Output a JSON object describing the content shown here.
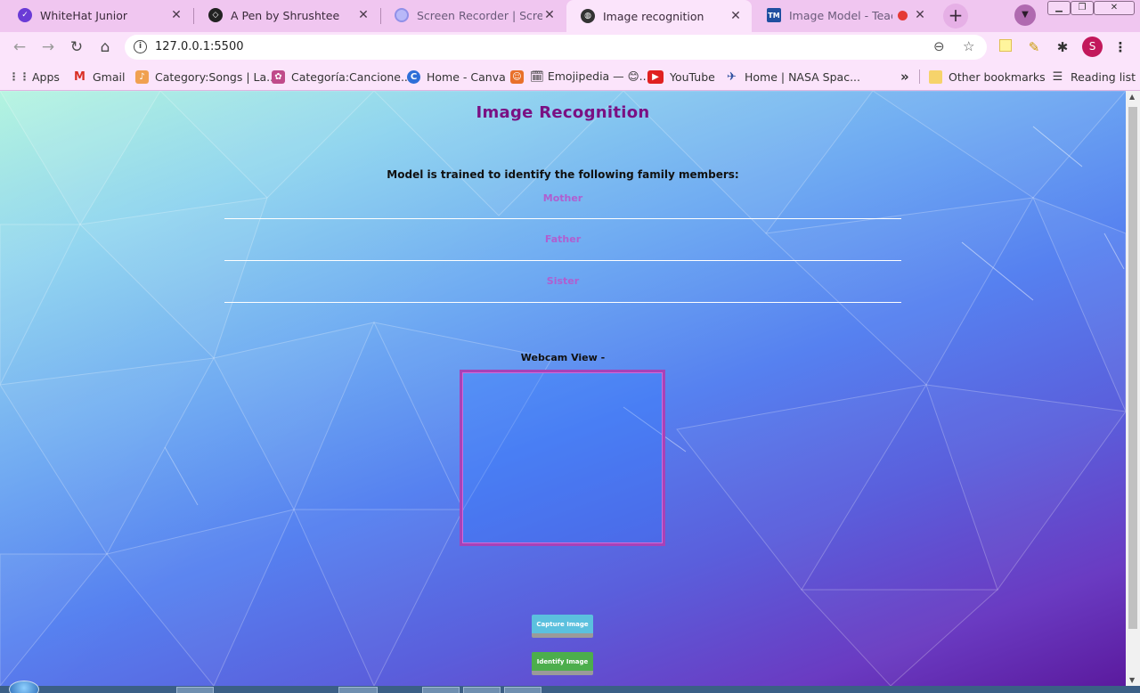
{
  "browser": {
    "tabs": [
      {
        "title": "WhiteHat Junior",
        "icon": "whitehat-icon"
      },
      {
        "title": "A Pen by Shrushtee",
        "icon": "codepen-icon"
      },
      {
        "title": "Screen Recorder | Screencast",
        "icon": "screencast-icon"
      },
      {
        "title": "Image recognition",
        "icon": "globe-icon",
        "active": true
      },
      {
        "title": "Image Model - Teachable Machine",
        "icon": "tm-icon"
      }
    ],
    "tab_close": "✕",
    "new_tab": "+",
    "url": "127.0.0.1:5500",
    "profile_initial": "S",
    "bookmarks": [
      {
        "label": "Apps",
        "icon": "apps-icon"
      },
      {
        "label": "Gmail",
        "icon": "gmail-icon"
      },
      {
        "label": "Category:Songs | La...",
        "icon": "bookmark-icon"
      },
      {
        "label": "Categoría:Cancione...",
        "icon": "bookmark-icon"
      },
      {
        "label": "Home - Canva",
        "icon": "canva-icon"
      },
      {
        "label": "🗓 Emojipedia — 😊...",
        "icon": "emojipedia-icon"
      },
      {
        "label": "YouTube",
        "icon": "youtube-icon"
      },
      {
        "label": "Home | NASA Spac...",
        "icon": "nasa-icon"
      }
    ],
    "more_bookmarks": "»",
    "other_bookmarks": "Other bookmarks",
    "reading_list": "Reading list"
  },
  "page": {
    "title": "Image Recognition",
    "trained_text": "Model is trained to identify the following family members:",
    "members": [
      "Mother",
      "Father",
      "Sister"
    ],
    "webcam_label": "Webcam View -",
    "capture_button": "Capture Image",
    "identify_button": "Identify Image"
  },
  "colors": {
    "title": "#7a1083",
    "member_text": "#b05ed0",
    "webcam_border": "#a742b8",
    "capture_button": "#5bc0de",
    "identify_button": "#4cae4c"
  }
}
